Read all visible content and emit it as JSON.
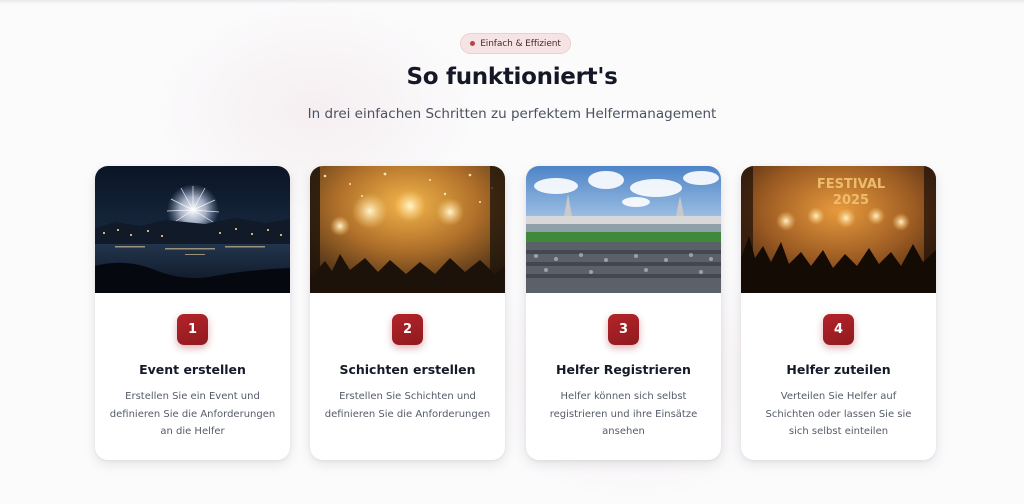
{
  "section": {
    "badge_label": "Einfach & Effizient",
    "title": "So funktioniert's",
    "subtitle": "In drei einfachen Schritten zu perfektem Helfermanagement"
  },
  "steps": [
    {
      "number": "1",
      "title": "Event erstellen",
      "description": "Erstellen Sie ein Event und definieren Sie die Anforderungen an die Helfer",
      "image": "fireworks-over-city-night-photo"
    },
    {
      "number": "2",
      "title": "Schichten erstellen",
      "description": "Erstellen Sie Schichten und definieren Sie die Anforderungen",
      "image": "concert-stage-lights-confetti-photo"
    },
    {
      "number": "3",
      "title": "Helfer Registrieren",
      "description": "Helfer können sich selbst registrieren und ihre Einsätze ansehen",
      "image": "stadium-crowd-photo"
    },
    {
      "number": "4",
      "title": "Helfer zuteilen",
      "description": "Verteilen Sie Helfer auf Schichten oder lassen Sie sie sich selbst einteilen",
      "image": "festival-crowd-photo",
      "image_sign_text": "FESTIVAL 2025"
    }
  ],
  "colors": {
    "accent": "#a11f25",
    "badge_bg": "#f6e4e4",
    "title": "#141826",
    "text": "#555b68"
  }
}
